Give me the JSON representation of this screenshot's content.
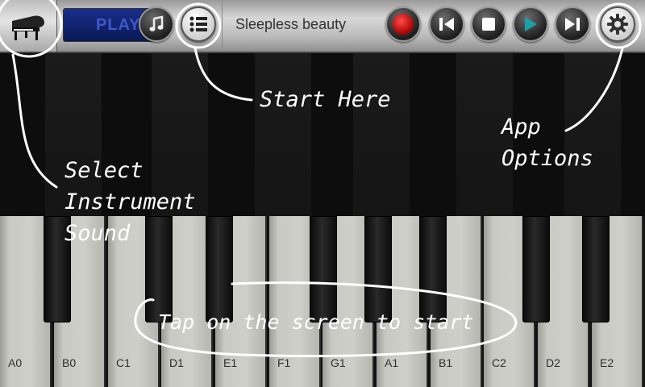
{
  "toolbar": {
    "display_text": "PLAY",
    "song_title": "Sleepless beauty",
    "buttons": {
      "instrument": "grand-piano-icon",
      "music_note": "music-note-icon",
      "song_list": "list-icon",
      "record": "record-icon",
      "previous": "skip-previous-icon",
      "stop": "stop-icon",
      "play": "play-icon",
      "next": "skip-next-icon",
      "settings": "gear-icon"
    }
  },
  "keys": {
    "white": [
      "A0",
      "B0",
      "C1",
      "D1",
      "E1",
      "F1",
      "G1",
      "A1",
      "B1",
      "C2",
      "D2",
      "E2"
    ]
  },
  "annotations": {
    "start_here": "Start Here",
    "app_options_line1": "App",
    "app_options_line2": "Options",
    "select_line1": "Select",
    "select_line2": "Instrument",
    "select_line3": "Sound",
    "tap_to_start": "Tap on the screen to start"
  },
  "colors": {
    "record": "#c21414",
    "play_accent": "#1aa0a8",
    "lcd": "#0f2070"
  }
}
